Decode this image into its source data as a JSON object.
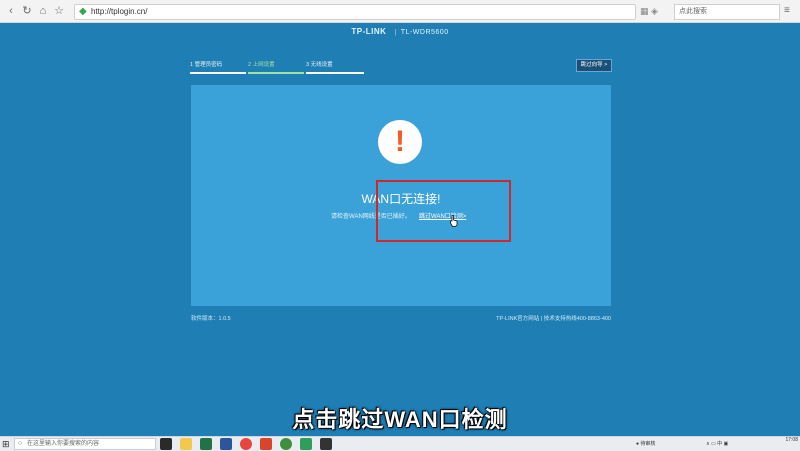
{
  "browser": {
    "url": "http://tplogin.cn/",
    "search_placeholder": "点此搜索",
    "back_icon": "‹",
    "forward_icon": "›",
    "reload_icon": "↻",
    "home_icon": "⌂",
    "star_icon": "☆",
    "shield_icon": "◆",
    "menu_icon": "≡",
    "tools_icons": "▦ ◈"
  },
  "brand": {
    "logo": "TP-LINK",
    "separator": "|",
    "model": "TL-WDR5600"
  },
  "steps": [
    {
      "label": "1 管理员密码"
    },
    {
      "label": "2 上网设置"
    },
    {
      "label": "3 无线设置"
    }
  ],
  "skip_guide_label": "跳过向导 >",
  "panel": {
    "warning_symbol": "!",
    "title": "WAN口无连接!",
    "message": "请检查WAN网线是否已插好。",
    "link": "跳过WAN口检测>"
  },
  "footer": {
    "version": "软件版本：1.0.5",
    "links": "TP-LINK官方网站  |  技术支持热线400-8863-400"
  },
  "subtitle": "点击跳过WAN口检测",
  "taskbar": {
    "start_icon": "⊞",
    "search_icon": "○",
    "search_placeholder": "在这里输入你要搜索的内容",
    "tray_left": "● 待审核",
    "tray_right": "∧ ▭ 中 ▣",
    "clock_time": "17:08"
  },
  "colors": {
    "page_bg": "#1f7fb5",
    "panel_bg": "#3ba2d9",
    "active_step": "#9fe2a6",
    "warning": "#f25c22",
    "highlight_box": "#d02828"
  }
}
